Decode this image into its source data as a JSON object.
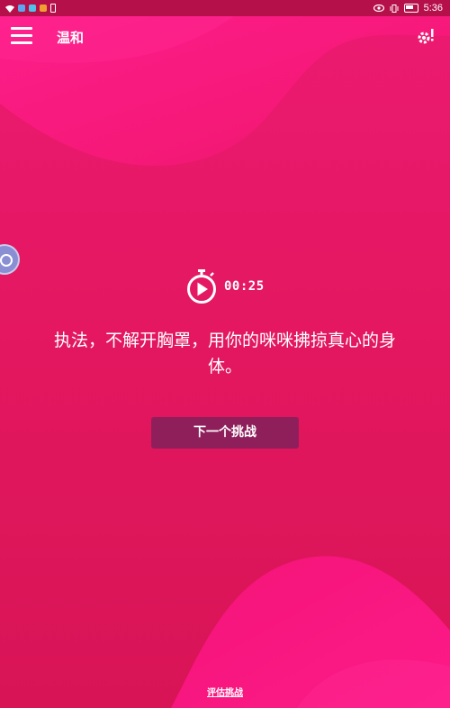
{
  "status_bar": {
    "time": "5:36",
    "icons": [
      "wifi-icon",
      "notification-icon",
      "notification-icon",
      "notification-icon",
      "eye-icon",
      "vibrate-icon",
      "battery-icon"
    ]
  },
  "app_bar": {
    "title": "温和",
    "menu_icon": "hamburger-menu-icon",
    "settings_icon": "gear-alert-icon"
  },
  "timer": {
    "icon": "stopwatch-play-icon",
    "value": "00:25"
  },
  "challenge": {
    "text": "执法，不解开胸罩，用你的咪咪拂掠真心的身体。"
  },
  "actions": {
    "next_label": "下一个挑战",
    "rate_label": "评估挑战"
  },
  "colors": {
    "background": "#e0175f",
    "accent_wave": "#ff1a80",
    "button": "#8e1f5b",
    "text": "#ffffff"
  }
}
